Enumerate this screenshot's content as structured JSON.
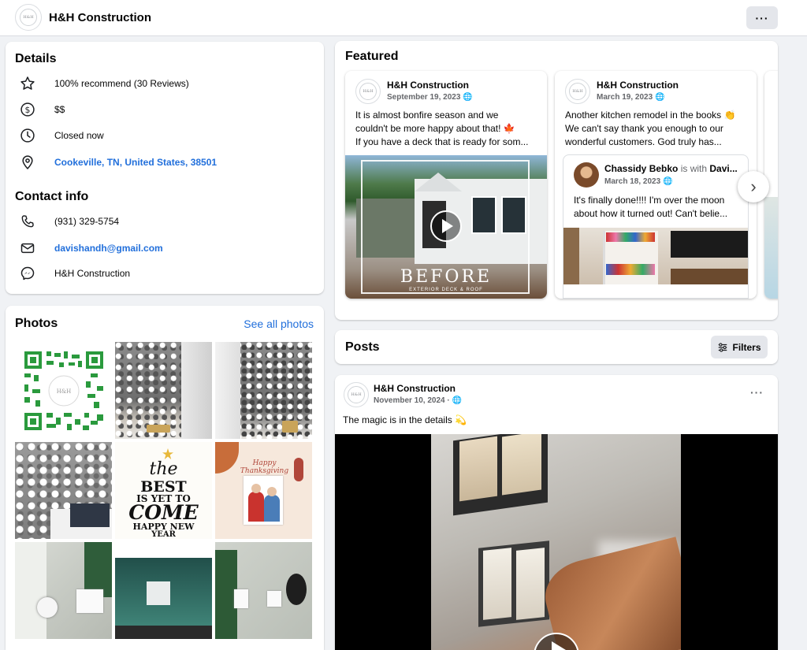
{
  "page": {
    "name": "H&H Construction",
    "logo_text": "H&H"
  },
  "details": {
    "title": "Details",
    "recommend": "100% recommend (30 Reviews)",
    "price": "$$",
    "hours": "Closed now",
    "location": "Cookeville, TN, United States, 38501"
  },
  "contact": {
    "title": "Contact info",
    "phone": "(931) 329-5754",
    "email": "davishandh@gmail.com",
    "messenger": "H&H Construction"
  },
  "photos": {
    "title": "Photos",
    "see_all": "See all photos",
    "newyear_line1": "the",
    "newyear_line2": "BEST",
    "newyear_line3": "IS YET TO",
    "newyear_line4": "COME",
    "newyear_line5": "HAPPY NEW",
    "newyear_line6": "YEAR",
    "thanks_text": "Happy Thanksgiving"
  },
  "featured": {
    "title": "Featured",
    "card1": {
      "name": "H&H Construction",
      "date": "September 19, 2023",
      "line1": "It is almost bonfire season and we",
      "line2": "couldn't be more happy about that! 🍁",
      "line3": "If you have a deck that is ready for som...",
      "overlay_title": "BEFORE",
      "overlay_sub": "EXTERIOR DECK & ROOF"
    },
    "card2": {
      "name": "H&H Construction",
      "date": "March 19, 2023",
      "line1": "Another kitchen remodel in the books 👏",
      "line2": "We can't say thank you enough to our",
      "line3": "wonderful customers. God truly has...",
      "shared_name": "Chassidy Bebko",
      "shared_with": " is with ",
      "shared_with_name": "Davi...",
      "shared_date": "March 18, 2023",
      "shared_line1": "It's finally done!!!! I'm over the moon",
      "shared_line2": "about how it turned out! Can't belie..."
    }
  },
  "posts": {
    "title": "Posts",
    "filters": "Filters",
    "post1": {
      "name": "H&H Construction",
      "date": "November 10, 2024 ·",
      "text": "The magic is in the details 💫"
    }
  },
  "colors": {
    "link": "#216fdb",
    "background": "#f0f2f5",
    "button_gray": "#e4e6eb"
  }
}
